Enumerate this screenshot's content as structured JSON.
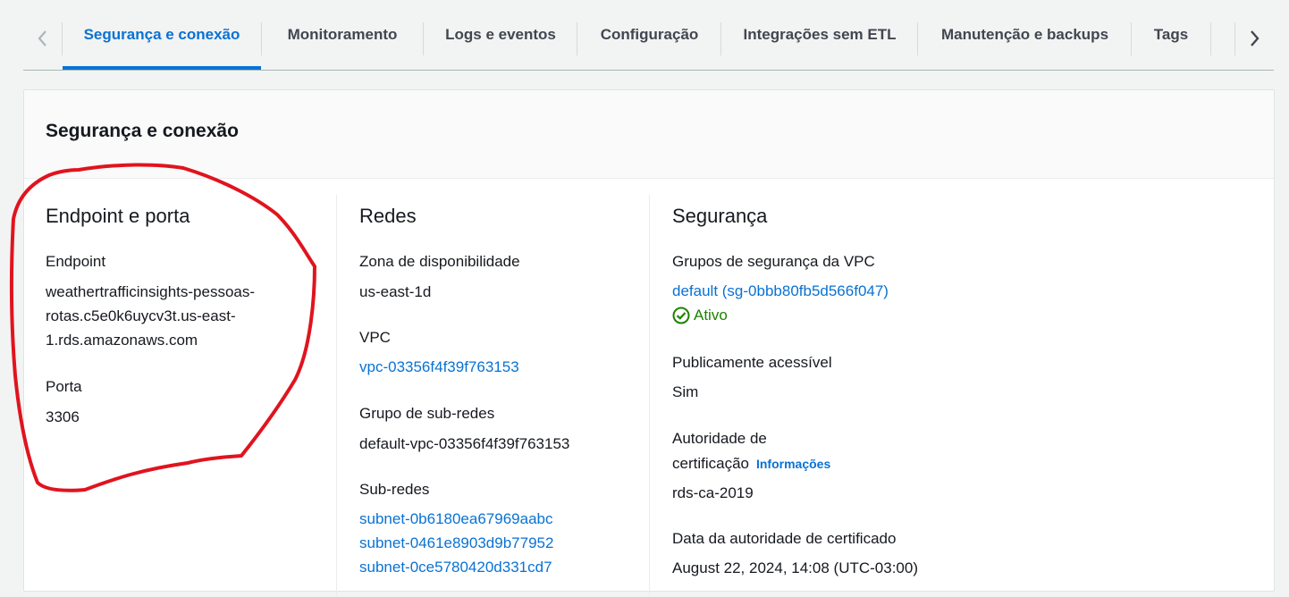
{
  "tabs": {
    "items": [
      {
        "label": "Segurança e conexão",
        "active": true
      },
      {
        "label": "Monitoramento"
      },
      {
        "label": "Logs e eventos"
      },
      {
        "label": "Configuração"
      },
      {
        "label": "Integrações sem ETL"
      },
      {
        "label": "Manutenção e backups"
      },
      {
        "label": "Tags"
      }
    ]
  },
  "panel": {
    "title": "Segurança e conexão"
  },
  "endpoint_section": {
    "title": "Endpoint e porta",
    "endpoint_label": "Endpoint",
    "endpoint_line1": "weathertrafficinsights-pessoas-",
    "endpoint_line2": "rotas.c5e0k6uycv3t.us-east-",
    "endpoint_line3": "1.rds.amazonaws.com",
    "port_label": "Porta",
    "port_value": "3306"
  },
  "network_section": {
    "title": "Redes",
    "az_label": "Zona de disponibilidade",
    "az_value": "us-east-1d",
    "vpc_label": "VPC",
    "vpc_value": "vpc-03356f4f39f763153",
    "subnet_group_label": "Grupo de sub-redes",
    "subnet_group_value": "default-vpc-03356f4f39f763153",
    "subnets_label": "Sub-redes",
    "subnets": [
      "subnet-0b6180ea67969aabc",
      "subnet-0461e8903d9b77952",
      "subnet-0ce5780420d331cd7"
    ]
  },
  "security_section": {
    "title": "Segurança",
    "sg_label": "Grupos de segurança da VPC",
    "sg_value": "default (sg-0bbb80fb5d566f047)",
    "sg_status": "Ativo",
    "public_label": "Publicamente acessível",
    "public_value": "Sim",
    "ca_label_line1": "Autoridade de",
    "ca_label_line2": "certificação",
    "ca_info": "Informações",
    "ca_value": "rds-ca-2019",
    "ca_date_label": "Data da autoridade de certificado",
    "ca_date_value": "August 22, 2024, 14:08 (UTC-03:00)"
  },
  "colors": {
    "accent": "#0972d3",
    "success": "#1d8102",
    "annotation": "#e0141e"
  },
  "icons": {
    "tab_prev": "chevron-left-icon",
    "tab_next": "chevron-right-icon",
    "status": "check-circle-icon"
  }
}
